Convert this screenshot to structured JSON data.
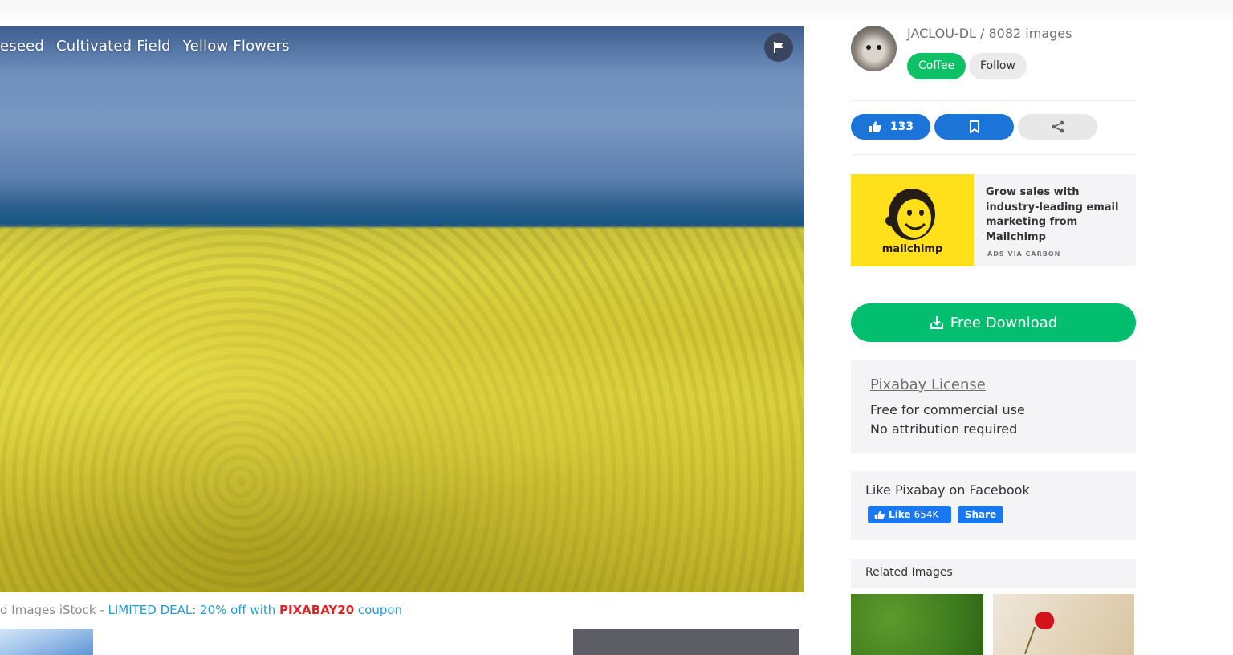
{
  "photo": {
    "tags": [
      "eseed",
      "Cultivated Field",
      "Yellow Flowers"
    ],
    "flag_icon": "flag-icon"
  },
  "istock": {
    "prefix": "d Images iStock - ",
    "deal": "LIMITED DEAL: 20% off with ",
    "code": "PIXABAY20",
    "suffix": " coupon"
  },
  "author": {
    "name": "JACLOU-DL / 8082 images",
    "coffee_label": "Coffee",
    "follow_label": "Follow"
  },
  "actions": {
    "like_count": "133",
    "like_icon": "thumbs-up-icon",
    "save_icon": "bookmark-icon",
    "share_icon": "share-icon"
  },
  "ad": {
    "brand": "mailchimp",
    "text": "Grow sales with industry-leading email marketing from Mailchimp",
    "via": "ADS VIA CARBON"
  },
  "download": {
    "label": "Free Download",
    "icon": "download-icon"
  },
  "license": {
    "title": "Pixabay License",
    "line1": "Free for commercial use",
    "line2": "No attribution required"
  },
  "facebook": {
    "title": "Like Pixabay on Facebook",
    "like_label": "Like",
    "like_count": "654K",
    "share_label": "Share"
  },
  "related": {
    "title": "Related Images"
  },
  "colors": {
    "green": "#02be6e",
    "blue": "#1b75d8",
    "deal_blue": "#1e9bd7",
    "coupon_red": "#e32323",
    "facebook_blue": "#1877f2"
  }
}
